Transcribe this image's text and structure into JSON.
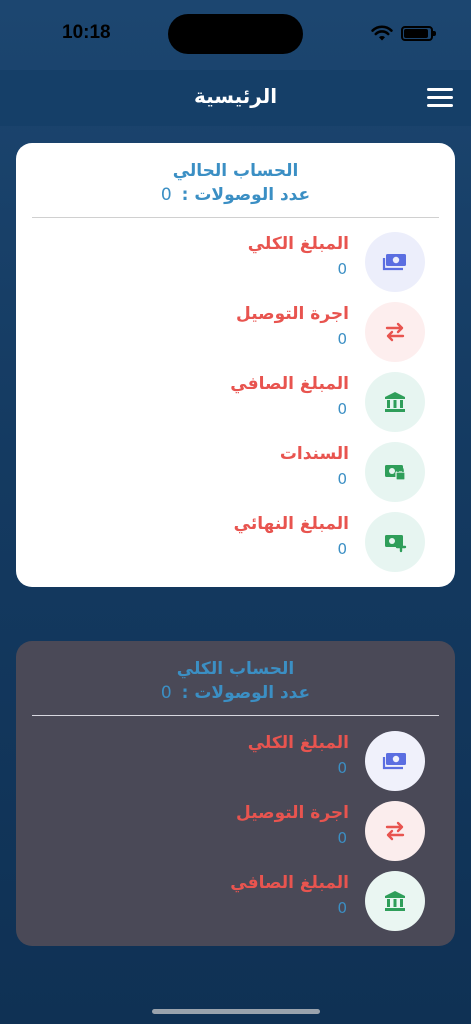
{
  "status_bar": {
    "time": "10:18"
  },
  "header": {
    "title": "الرئيسية"
  },
  "current_account": {
    "title": "الحساب الحالي",
    "count_label": "عدد الوصولات :",
    "count_value": "0",
    "items": [
      {
        "label": "المبلغ الكلي",
        "value": "0",
        "icon": "money-bill-icon",
        "color": "#5b6ee1"
      },
      {
        "label": "اجرة التوصيل",
        "value": "0",
        "icon": "exchange-arrows-icon",
        "color": "#e8544f"
      },
      {
        "label": "المبلغ الصافي",
        "value": "0",
        "icon": "bank-icon",
        "color": "#2f9e5a"
      },
      {
        "label": "السندات",
        "value": "0",
        "icon": "money-lock-icon",
        "color": "#2f9e5a"
      },
      {
        "label": "المبلغ النهائي",
        "value": "0",
        "icon": "money-plus-icon",
        "color": "#2f9e5a"
      }
    ]
  },
  "total_account": {
    "title": "الحساب الكلي",
    "count_label": "عدد الوصولات :",
    "count_value": "0",
    "items": [
      {
        "label": "المبلغ الكلي",
        "value": "0",
        "icon": "money-bill-icon",
        "color": "#5b6ee1"
      },
      {
        "label": "اجرة التوصيل",
        "value": "0",
        "icon": "exchange-arrows-icon",
        "color": "#e8544f"
      },
      {
        "label": "المبلغ الصافي",
        "value": "0",
        "icon": "bank-icon",
        "color": "#2f9e5a"
      }
    ]
  }
}
